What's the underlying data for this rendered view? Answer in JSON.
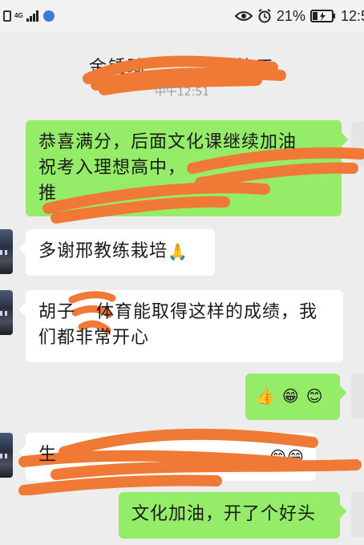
{
  "status_bar": {
    "network_type": "4G",
    "battery_percent": "21%",
    "time": "12:5"
  },
  "chat": {
    "title": "金锈琦",
    "title_suffix": "莫协三",
    "timestamp": "中午12:51"
  },
  "messages": [
    {
      "direction": "out",
      "lines": [
        "恭喜满分，后面文化课继续加油",
        "祝考入理想高中，",
        "推"
      ]
    },
    {
      "direction": "in",
      "text": "多谢邢教练栽培",
      "emoji": "🙏"
    },
    {
      "direction": "in",
      "lines": [
        "胡子",
        "体育能取得这样的成绩，我",
        "们都非常开心"
      ]
    },
    {
      "direction": "out",
      "emojis": [
        "👍",
        "😁",
        "😊"
      ]
    },
    {
      "direction": "in",
      "text": "生",
      "emojis": [
        "😊",
        "😁"
      ]
    },
    {
      "direction": "out",
      "text": "文化加油，开了个好头"
    }
  ],
  "colors": {
    "background": "#ededed",
    "outgoing_bubble": "#95ec69",
    "incoming_bubble": "#ffffff",
    "redaction": "#f07a35"
  }
}
